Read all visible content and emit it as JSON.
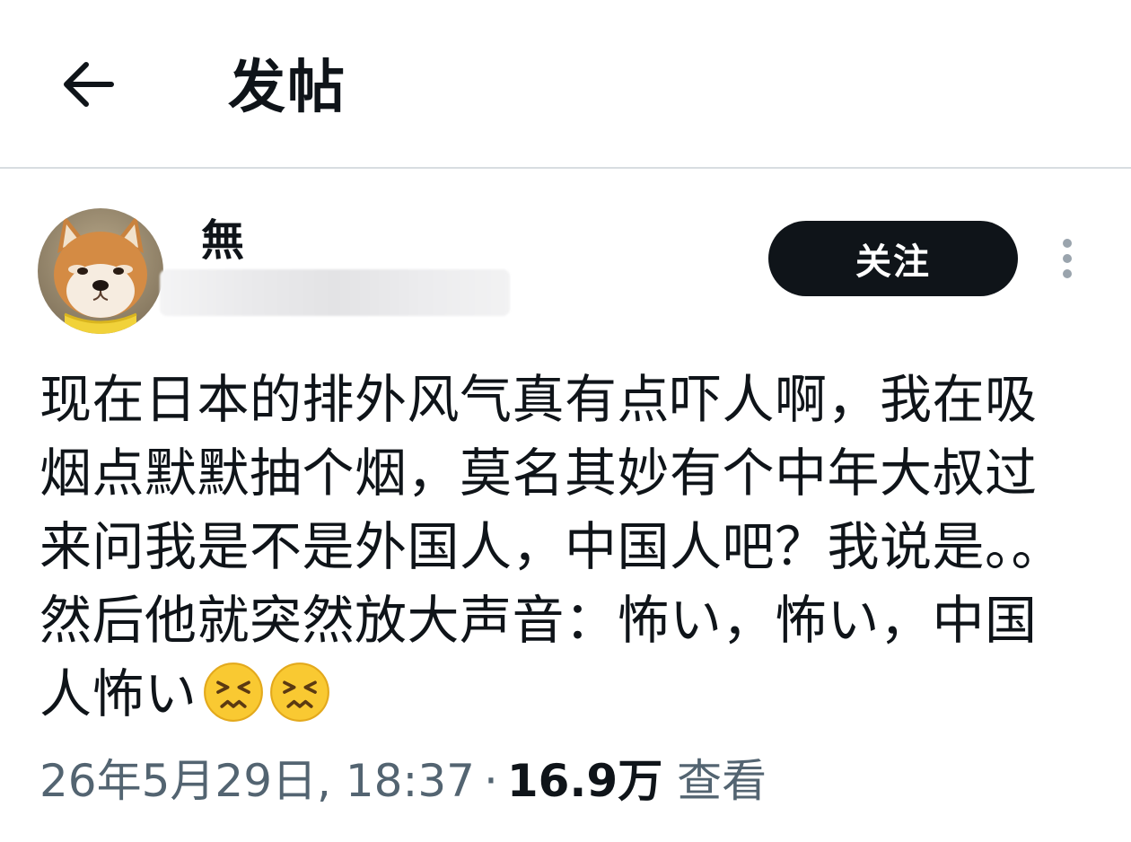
{
  "header": {
    "back_icon": "arrow-left-icon",
    "title": "发帖"
  },
  "author": {
    "display_name": "無",
    "handle": "",
    "avatar_icon": "shiba-inu-avatar",
    "follow_label": "关注",
    "more_icon": "more-vertical-icon"
  },
  "post": {
    "text": "现在日本的排外风气真有点吓人啊，我在吸烟点默默抽个烟，莫名其妙有个中年大叔过来问我是不是外国人，中国人吧？我说是。。然后他就突然放大声音：怖い，怖い，中国人怖い",
    "emojis": [
      "persevering-face-emoji",
      "persevering-face-emoji"
    ]
  },
  "meta": {
    "timestamp": "26年5月29日, 18:37",
    "separator": "·",
    "views_count": "16.9万",
    "views_label": "查看"
  },
  "colors": {
    "text_primary": "#0f1419",
    "text_secondary": "#536471",
    "button_bg": "#0f1419",
    "divider": "#d8dde1"
  }
}
